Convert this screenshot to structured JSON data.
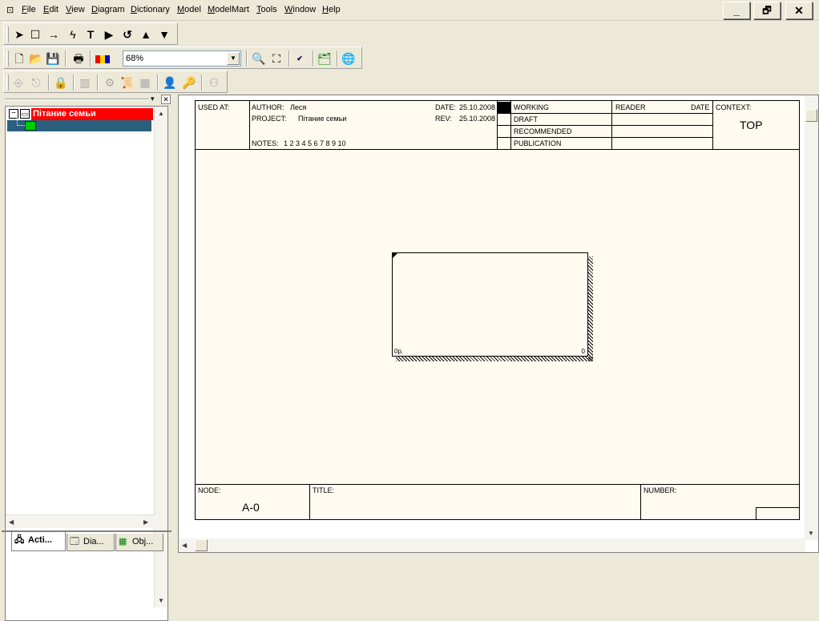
{
  "menu": {
    "items": [
      {
        "label": "File",
        "u": "F",
        "rest": "ile"
      },
      {
        "label": "Edit",
        "u": "E",
        "rest": "dit"
      },
      {
        "label": "View",
        "u": "V",
        "rest": "iew"
      },
      {
        "label": "Diagram",
        "u": "D",
        "rest": "iagram"
      },
      {
        "label": "Dictionary",
        "u": "D",
        "rest": "ictionary"
      },
      {
        "label": "Model",
        "u": "M",
        "rest": "odel"
      },
      {
        "label": "ModelMart",
        "u": "M",
        "rest": "odelMart"
      },
      {
        "label": "Tools",
        "u": "T",
        "rest": "ools"
      },
      {
        "label": "Window",
        "u": "W",
        "rest": "indow"
      },
      {
        "label": "Help",
        "u": "H",
        "rest": "elp"
      }
    ]
  },
  "window_controls": {
    "minimize": "_",
    "restore": "🗗",
    "close": "✕"
  },
  "toolbar": {
    "zoom": "68%"
  },
  "tree": {
    "root_label": "Пітание семьи"
  },
  "tabs": [
    {
      "label": "Acti..."
    },
    {
      "label": "Dia..."
    },
    {
      "label": "Obj..."
    }
  ],
  "header": {
    "used_at": "USED AT:",
    "author_label": "AUTHOR:",
    "author": "Леся",
    "project_label": "PROJECT:",
    "project": "Пітание семьи",
    "date_label": "DATE:",
    "date": "25.10.2008",
    "rev_label": "REV:",
    "rev": "25.10.2008",
    "notes_label": "NOTES:",
    "notes": "1  2  3  4  5  6  7  8  9  10",
    "status": [
      "WORKING",
      "DRAFT",
      "RECOMMENDED",
      "PUBLICATION"
    ],
    "reader": "READER",
    "reader_date": "DATE",
    "context": "CONTEXT:",
    "context_value": "TOP"
  },
  "footer": {
    "node_label": "NODE:",
    "node": "A-0",
    "title_label": "TITLE:",
    "number_label": "NUMBER:"
  },
  "box": {
    "cost": "0р.",
    "number": "0"
  }
}
